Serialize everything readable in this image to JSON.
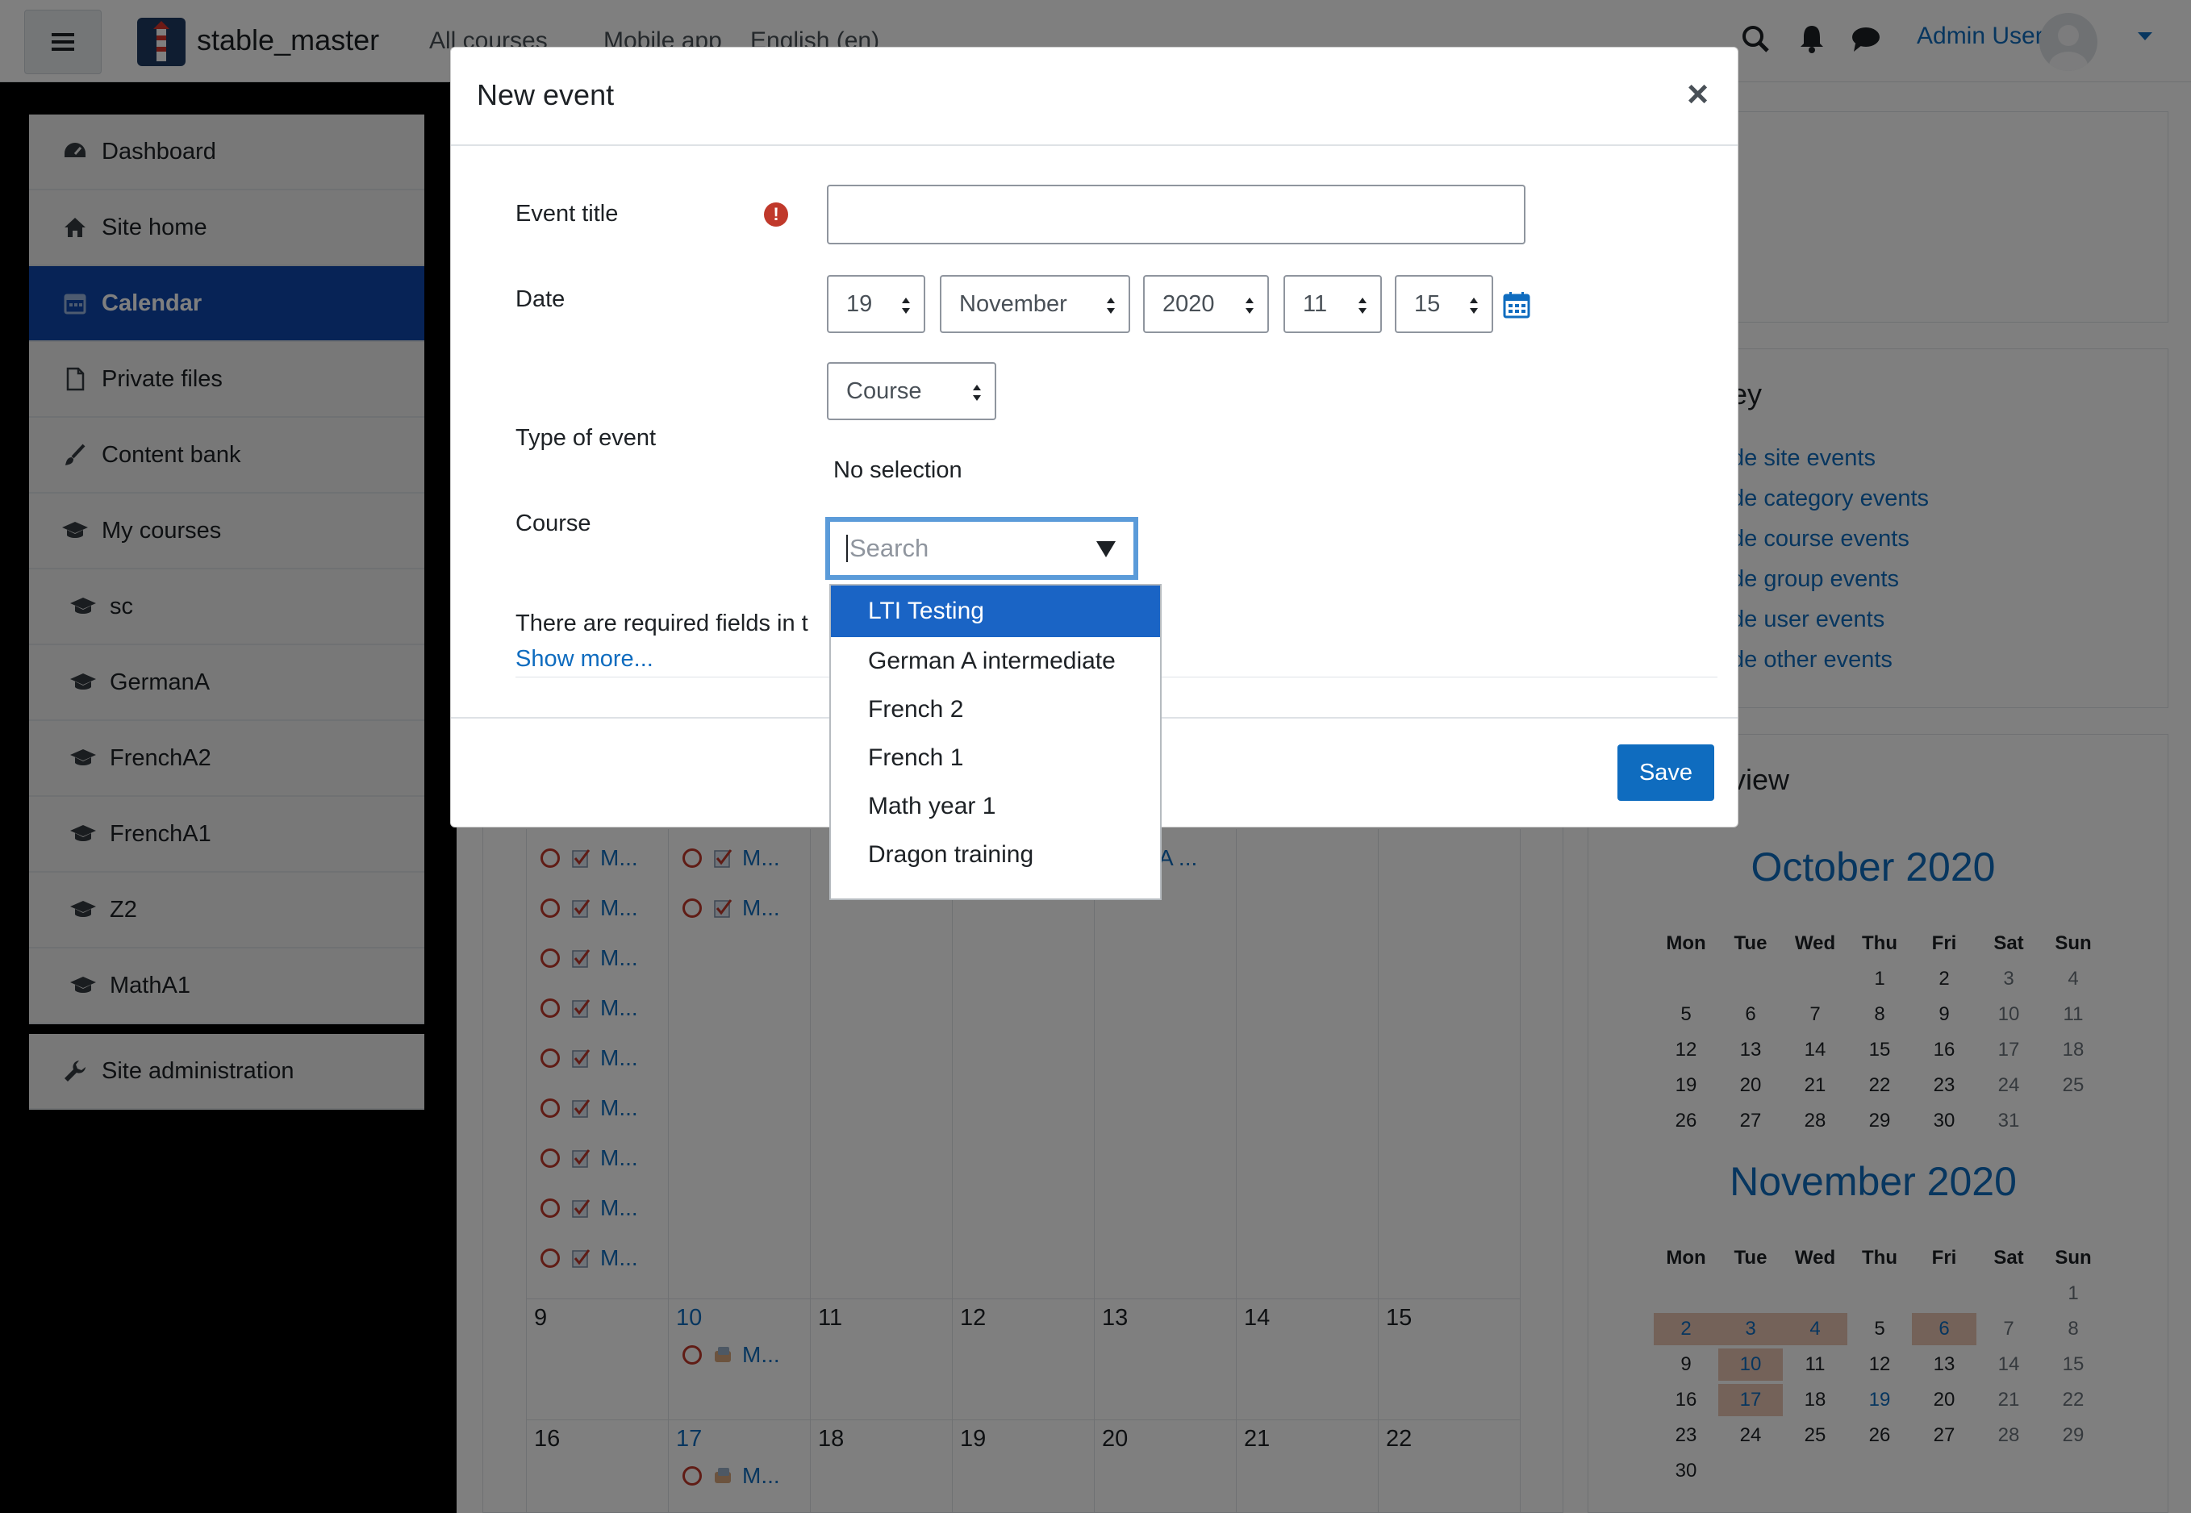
{
  "navbar": {
    "site_name": "stable_master",
    "menu": [
      "All courses",
      "Mobile app",
      "English (en)"
    ],
    "user": "Admin User"
  },
  "drawer": {
    "items": [
      {
        "label": "Dashboard",
        "icon": "dashboard-icon"
      },
      {
        "label": "Site home",
        "icon": "home-icon"
      },
      {
        "label": "Calendar",
        "icon": "calendar-icon",
        "active": true
      },
      {
        "label": "Private files",
        "icon": "file-icon"
      },
      {
        "label": "Content bank",
        "icon": "brush-icon"
      },
      {
        "label": "My courses",
        "icon": "graduation-cap-icon"
      },
      {
        "label": "sc",
        "icon": "graduation-cap-icon"
      },
      {
        "label": "GermanA",
        "icon": "graduation-cap-icon"
      },
      {
        "label": "FrenchA2",
        "icon": "graduation-cap-icon"
      },
      {
        "label": "FrenchA1",
        "icon": "graduation-cap-icon"
      },
      {
        "label": "Z2",
        "icon": "graduation-cap-icon"
      },
      {
        "label": "MathA1",
        "icon": "graduation-cap-icon"
      }
    ],
    "admin": {
      "label": "Site administration",
      "icon": "wrench-icon"
    }
  },
  "key_block": {
    "title_fragment": "ey",
    "links": [
      "de site events",
      "de category events",
      "de course events",
      "de group events",
      "de user events",
      "de other events"
    ]
  },
  "overview_block": {
    "title_fragment": "view",
    "weekdays": [
      "Mon",
      "Tue",
      "Wed",
      "Thu",
      "Fri",
      "Sat",
      "Sun"
    ],
    "october": {
      "title": "October 2020",
      "rows": [
        [
          "",
          "",
          "",
          "1",
          "2",
          "3",
          "4"
        ],
        [
          "5",
          "6",
          "7",
          "8",
          "9",
          "10",
          "11"
        ],
        [
          "12",
          "13",
          "14",
          "15",
          "16",
          "17",
          "18"
        ],
        [
          "19",
          "20",
          "21",
          "22",
          "23",
          "24",
          "25"
        ],
        [
          "26",
          "27",
          "28",
          "29",
          "30",
          "31",
          ""
        ]
      ]
    },
    "november": {
      "title": "November 2020",
      "rows": [
        [
          "",
          "",
          "",
          "",
          "",
          "",
          "1"
        ],
        [
          "2",
          "3",
          "4",
          "5",
          "6",
          "7",
          "8"
        ],
        [
          "9",
          "10",
          "11",
          "12",
          "13",
          "14",
          "15"
        ],
        [
          "16",
          "17",
          "18",
          "19",
          "20",
          "21",
          "22"
        ],
        [
          "23",
          "24",
          "25",
          "26",
          "27",
          "28",
          "29"
        ],
        [
          "30",
          "",
          "",
          "",
          "",
          "",
          ""
        ]
      ]
    }
  },
  "calendar": {
    "event_label": "M...",
    "event_label_a": "A ...",
    "week_row_a": [
      "9",
      "10",
      "11",
      "12",
      "13",
      "14",
      "15"
    ],
    "week_row_b": [
      "16",
      "17",
      "18",
      "19",
      "20",
      "21",
      "22"
    ]
  },
  "modal": {
    "title": "New event",
    "close": "×",
    "event_title_label": "Event title",
    "event_title_value": "",
    "date_label": "Date",
    "date": {
      "day": "19",
      "month": "November",
      "year": "2020",
      "hour": "11",
      "minute": "15"
    },
    "type_label": "Type of event",
    "type_value": "Course",
    "course_label": "Course",
    "no_selection": "No selection",
    "search_placeholder": "Search",
    "required_text": "There are required fields in t",
    "show_more": "Show more...",
    "save": "Save"
  },
  "dropdown": {
    "options": [
      "LTI Testing",
      "German A intermediate",
      "French 2",
      "French 1",
      "Math year 1",
      "Dragon training"
    ],
    "selected_index": 0
  },
  "colors": {
    "accent": "#0f6cbf",
    "drawer_active": "#0f47ad",
    "highlight_day": "#e8c4b3",
    "required": "#c0392b"
  }
}
